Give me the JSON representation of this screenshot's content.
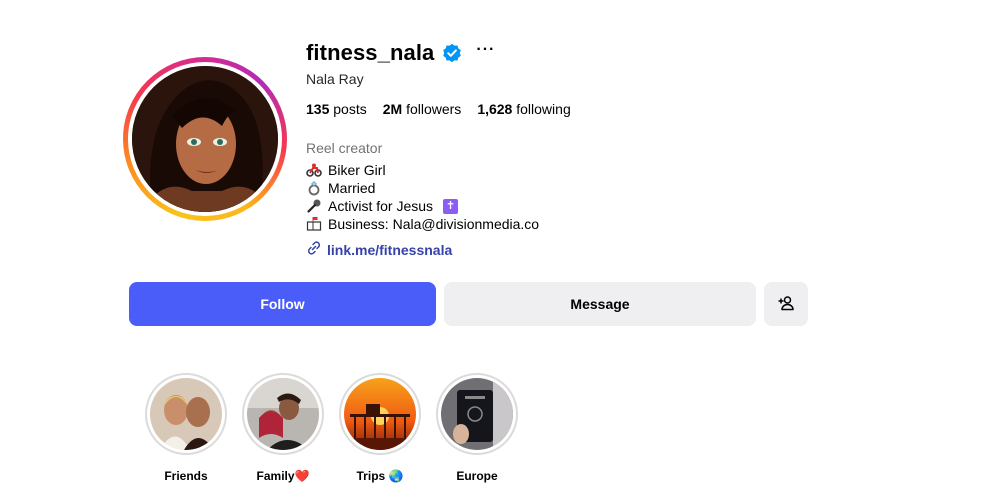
{
  "profile": {
    "username": "fitness_nala",
    "more_label": "···",
    "full_name": "Nala Ray",
    "stats": {
      "posts_count": "135",
      "posts_label": "posts",
      "followers_count": "2M",
      "followers_label": "followers",
      "following_count": "1,628",
      "following_label": "following"
    },
    "category": "Reel creator",
    "bio_lines": [
      {
        "icon": "motorcycle-emoji",
        "text": "Biker Girl"
      },
      {
        "icon": "ring-emoji",
        "text": "Married"
      },
      {
        "icon": "microphone-emoji",
        "text": "Activist for Jesus"
      },
      {
        "icon": "mailbox-emoji",
        "text": "Business: Nala@divisionmedia.co"
      }
    ],
    "cross_symbol": "✝",
    "link": "link.me/fitnessnala"
  },
  "actions": {
    "follow_label": "Follow",
    "message_label": "Message",
    "add_user_icon": "person-add-icon"
  },
  "highlights": [
    {
      "label": "Friends"
    },
    {
      "label": "Family❤️"
    },
    {
      "label": "Trips 🌏"
    },
    {
      "label": "Europe"
    }
  ],
  "colors": {
    "follow_button": "#4a5df9",
    "secondary_button": "#efeff2",
    "link": "#3542a8",
    "verified": "#0095f6"
  }
}
